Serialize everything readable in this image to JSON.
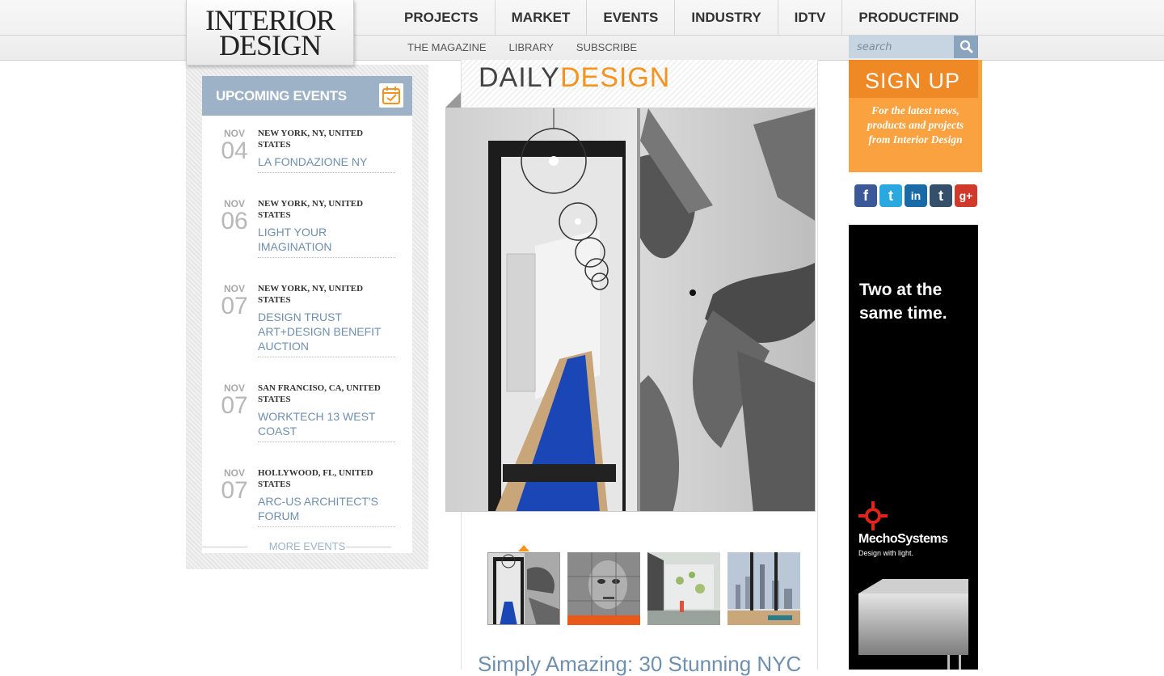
{
  "header": {
    "logo": {
      "line1": "INTERIOR",
      "line2": "DESIGN"
    },
    "main_nav": [
      "PROJECTS",
      "MARKET",
      "EVENTS",
      "INDUSTRY",
      "IDTV",
      "PRODUCTFIND"
    ],
    "sub_nav": [
      "THE MAGAZINE",
      "LIBRARY",
      "SUBSCRIBE"
    ],
    "search": {
      "placeholder": "search"
    }
  },
  "events": {
    "title": "UPCOMING EVENTS",
    "items": [
      {
        "month": "NOV",
        "day": "04",
        "location": "NEW YORK, NY, UNITED STATES",
        "name": "LA FONDAZIONE NY"
      },
      {
        "month": "NOV",
        "day": "06",
        "location": "NEW YORK, NY, UNITED STATES",
        "name": "LIGHT YOUR IMAGINATION"
      },
      {
        "month": "NOV",
        "day": "07",
        "location": "NEW YORK, NY, UNITED STATES",
        "name": "DESIGN TRUST ART+DESIGN BENEFIT AUCTION"
      },
      {
        "month": "NOV",
        "day": "07",
        "location": "SAN FRANCISO, CA, UNITED STATES",
        "name": "WORKTECH 13 WEST COAST"
      },
      {
        "month": "NOV",
        "day": "07",
        "location": "HOLLYWOOD, FL, UNITED STATES",
        "name": "ARC-US ARCHITECT'S FORUM"
      }
    ],
    "more_label": "MORE EVENTS"
  },
  "daily": {
    "title_part1": "DAILY",
    "title_part2": "DESIGN",
    "headline": "Simply Amazing: 30 Stunning NYC"
  },
  "signup": {
    "title": "SIGN UP",
    "text": "For the latest news, products and projects from Interior Design"
  },
  "social": [
    {
      "icon": "facebook-icon",
      "glyph": "f",
      "color": "#3b5998"
    },
    {
      "icon": "twitter-icon",
      "glyph": "t",
      "color": "#2aa9e0"
    },
    {
      "icon": "linkedin-icon",
      "glyph": "in",
      "color": "#1a6aa7"
    },
    {
      "icon": "tumblr-icon",
      "glyph": "t",
      "color": "#35506b"
    },
    {
      "icon": "googleplus-icon",
      "glyph": "g+",
      "color": "#d1392b"
    }
  ],
  "ad": {
    "headline": "Two at the same time.",
    "brand": "MechoSystems",
    "tagline": "Design with light."
  },
  "colors": {
    "accent_orange": "#f6921e",
    "link_blue": "#6f8fae",
    "events_header": "#9db2c7"
  }
}
